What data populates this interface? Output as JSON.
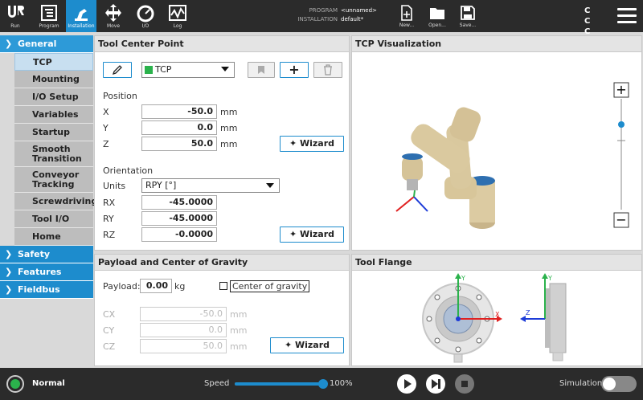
{
  "topbar": {
    "tabs": [
      {
        "label": "Run"
      },
      {
        "label": "Program"
      },
      {
        "label": "Installation"
      },
      {
        "label": "Move"
      },
      {
        "label": "I/O"
      },
      {
        "label": "Log"
      }
    ],
    "program_label": "PROGRAM",
    "program_value": "<unnamed>",
    "installation_label": "INSTALLATION",
    "installation_value": "default*",
    "new_label": "New...",
    "open_label": "Open...",
    "save_label": "Save...",
    "cc": "C C C C"
  },
  "sidebar": {
    "general": "General",
    "items": [
      "TCP",
      "Mounting",
      "I/O Setup",
      "Variables",
      "Startup",
      "Smooth Transition",
      "Conveyor Tracking",
      "Screwdriving",
      "Tool I/O",
      "Home"
    ],
    "safety": "Safety",
    "features": "Features",
    "fieldbus": "Fieldbus"
  },
  "tcp": {
    "title": "Tool Center Point",
    "selected": "TCP",
    "position_label": "Position",
    "x_label": "X",
    "x": "-50.0",
    "y_label": "Y",
    "y": "0.0",
    "z_label": "Z",
    "z": "50.0",
    "unit_mm": "mm",
    "wizard": "Wizard",
    "orientation_label": "Orientation",
    "units_label": "Units",
    "units_value": "RPY [°]",
    "rx_label": "RX",
    "rx": "-45.0000",
    "ry_label": "RY",
    "ry": "-45.0000",
    "rz_label": "RZ",
    "rz": "-0.0000"
  },
  "viz": {
    "title": "TCP Visualization"
  },
  "payload": {
    "title": "Payload and Center of Gravity",
    "payload_label": "Payload:",
    "payload_value": "0.00",
    "payload_unit": "kg",
    "cog_label": "Center of gravity",
    "cx_label": "CX",
    "cx": "-50.0",
    "cy_label": "CY",
    "cy": "0.0",
    "cz_label": "CZ",
    "cz": "50.0",
    "unit_mm": "mm",
    "wizard": "Wizard"
  },
  "flange": {
    "title": "Tool Flange",
    "axis_y": "Y",
    "axis_x": "X",
    "axis_z": "Z"
  },
  "bottombar": {
    "status": "Normal",
    "speed_label": "Speed",
    "speed_value": "100%",
    "speed_fraction": 1.0,
    "simulation_label": "Simulation"
  },
  "colors": {
    "accent": "#1d8ccd",
    "status_ok": "#2bb24c",
    "bar": "#2b2b2b"
  }
}
